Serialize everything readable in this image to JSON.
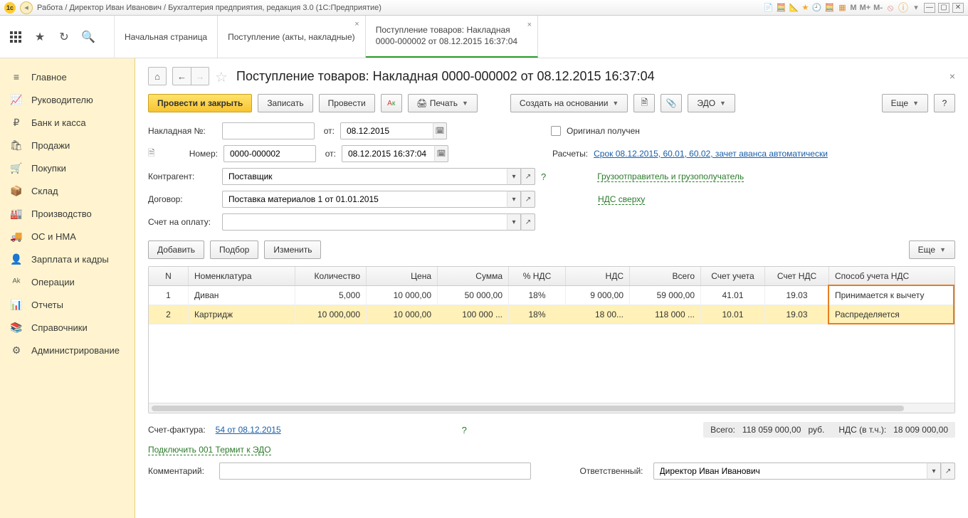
{
  "titlebar": {
    "path": "Работа / Директор Иван Иванович / Бухгалтерия предприятия, редакция 3.0  (1С:Предприятие)",
    "buttons": {
      "m": "M",
      "mplus": "M+",
      "mminus": "M-"
    }
  },
  "tabs": {
    "home": "Начальная страница",
    "receipts": "Поступление (акты, накладные)",
    "doc_line1": "Поступление товаров: Накладная",
    "doc_line2": "0000-000002 от 08.12.2015 16:37:04"
  },
  "sidebar": {
    "items": [
      {
        "icon": "≡",
        "label": "Главное"
      },
      {
        "icon": "📈",
        "label": "Руководителю"
      },
      {
        "icon": "₽",
        "label": "Банк и касса"
      },
      {
        "icon": "🛍",
        "label": "Продажи"
      },
      {
        "icon": "🛒",
        "label": "Покупки"
      },
      {
        "icon": "📦",
        "label": "Склад"
      },
      {
        "icon": "🏭",
        "label": "Производство"
      },
      {
        "icon": "🚚",
        "label": "ОС и НМА"
      },
      {
        "icon": "👤",
        "label": "Зарплата и кадры"
      },
      {
        "icon": "ᴬᵏ",
        "label": "Операции"
      },
      {
        "icon": "📊",
        "label": "Отчеты"
      },
      {
        "icon": "📚",
        "label": "Справочники"
      },
      {
        "icon": "⚙",
        "label": "Администрирование"
      }
    ]
  },
  "doc": {
    "title": "Поступление товаров: Накладная 0000-000002 от 08.12.2015 16:37:04",
    "buttons": {
      "post_close": "Провести и закрыть",
      "write": "Записать",
      "post": "Провести",
      "print": "Печать",
      "create_based": "Создать на основании",
      "edo": "ЭДО",
      "more": "Еще"
    },
    "labels": {
      "invoice_no": "Накладная №:",
      "from": "от:",
      "number": "Номер:",
      "counterparty": "Контрагент:",
      "contract": "Договор:",
      "payment_invoice": "Счет на оплату:",
      "original_received": "Оригинал получен",
      "calc": "Расчеты:",
      "calc_link": "Срок 08.12.2015, 60.01, 60.02, зачет аванса автоматически",
      "shipper_link": "Грузоотправитель и грузополучатель",
      "vat_link": "НДС сверху",
      "add": "Добавить",
      "pick": "Подбор",
      "change": "Изменить",
      "invoice": "Счет-фактура:",
      "invoice_link": "54 от 08.12.2015",
      "edo_connect": "Подключить 001 Термит к ЭДО",
      "comment": "Комментарий:",
      "responsible": "Ответственный:",
      "total": "Всего:",
      "total_val": "118 059 000,00",
      "rub": "руб.",
      "vat_incl": "НДС (в т.ч.):",
      "vat_val": "18 009 000,00"
    },
    "values": {
      "invoice_no": "",
      "date": "08.12.2015",
      "number": "0000-000002",
      "datetime": "08.12.2015 16:37:04",
      "counterparty": "Поставщик",
      "contract": "Поставка материалов 1 от 01.01.2015",
      "payment_invoice": "",
      "responsible": "Директор Иван Иванович",
      "comment": ""
    },
    "grid": {
      "headers": [
        "N",
        "Номенклатура",
        "Количество",
        "Цена",
        "Сумма",
        "% НДС",
        "НДС",
        "Всего",
        "Счет учета",
        "Счет НДС",
        "Способ учета НДС"
      ],
      "rows": [
        {
          "n": "1",
          "item": "Диван",
          "qty": "5,000",
          "price": "10 000,00",
          "sum": "50 000,00",
          "vat_pct": "18%",
          "vat": "9 000,00",
          "total": "59 000,00",
          "acc": "41.01",
          "vat_acc": "19.03",
          "method": "Принимается к вычету"
        },
        {
          "n": "2",
          "item": "Картридж",
          "qty": "10 000,000",
          "price": "10 000,00",
          "sum": "100 000 ...",
          "vat_pct": "18%",
          "vat": "18 00...",
          "total": "118 000 ...",
          "acc": "10.01",
          "vat_acc": "19.03",
          "method": "Распределяется"
        }
      ]
    }
  }
}
